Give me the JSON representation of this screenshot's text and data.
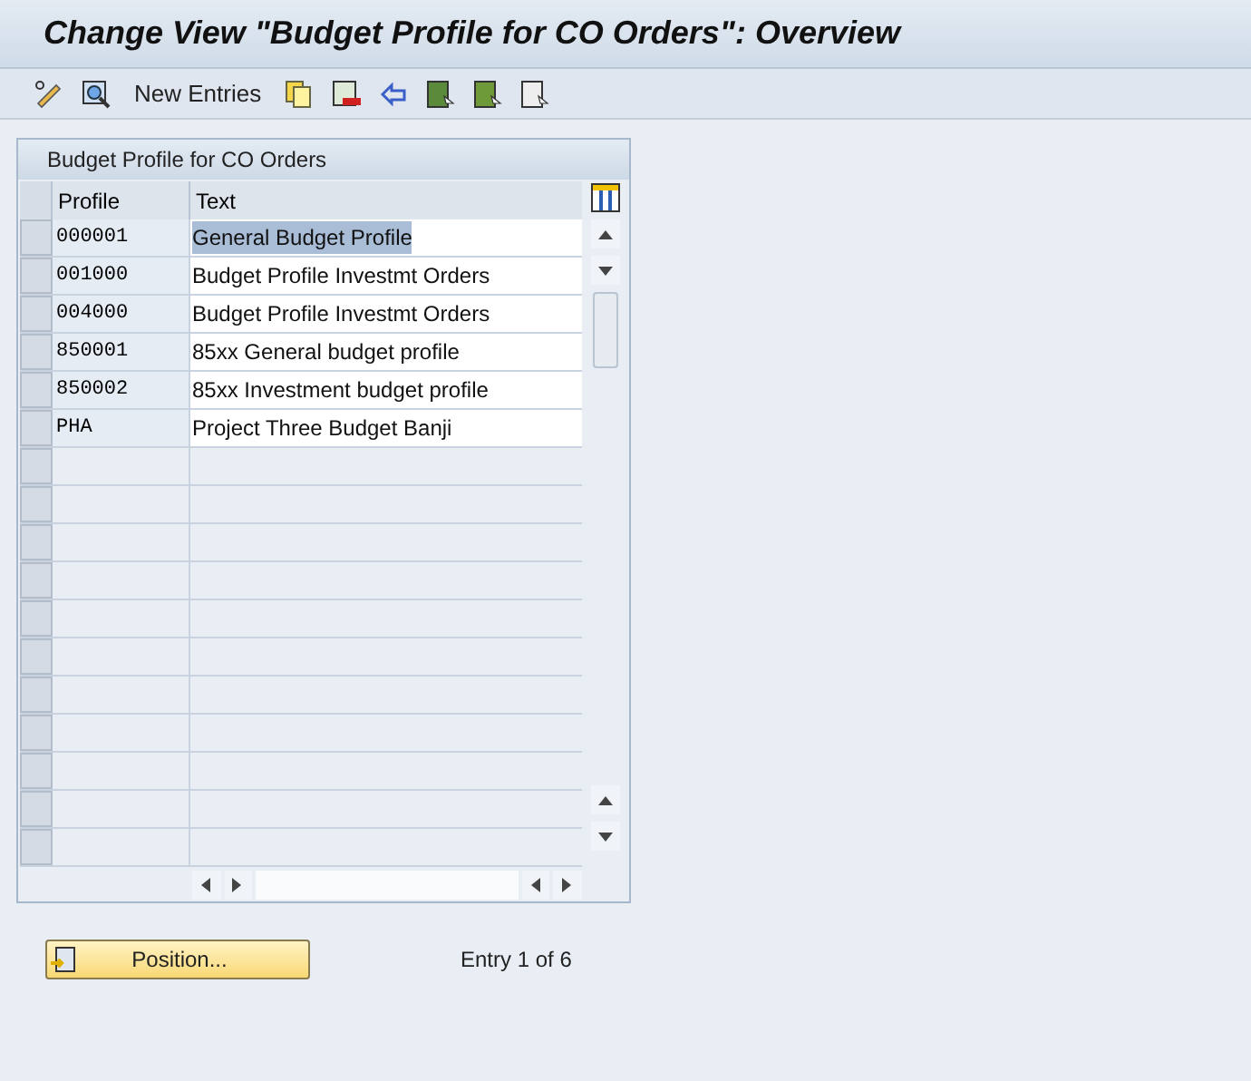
{
  "window": {
    "title": "Change View \"Budget Profile for CO Orders\": Overview"
  },
  "toolbar": {
    "new_entries": "New Entries"
  },
  "table": {
    "title": "Budget Profile for CO Orders",
    "columns": [
      "Profile",
      "Text"
    ],
    "rows": [
      {
        "profile": "000001",
        "text": "General Budget Profile",
        "selected": true
      },
      {
        "profile": "001000",
        "text": "Budget Profile Investmt Orders",
        "selected": false
      },
      {
        "profile": "004000",
        "text": "Budget Profile Investmt Orders",
        "selected": false
      },
      {
        "profile": "850001",
        "text": "85xx General budget profile",
        "selected": false
      },
      {
        "profile": "850002",
        "text": "85xx Investment budget profile",
        "selected": false
      },
      {
        "profile": "PHA",
        "text": "Project Three Budget Banji",
        "selected": false
      }
    ]
  },
  "footer": {
    "button": "Position...",
    "entry": "Entry 1 of 6"
  }
}
